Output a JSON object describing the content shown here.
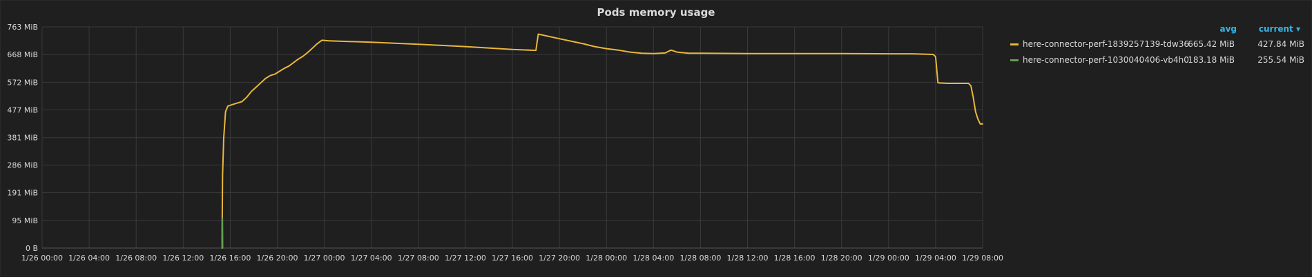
{
  "panel": {
    "title": "Pods memory usage"
  },
  "legend": {
    "avg_header": "avg",
    "current_header": "current ▾",
    "items": [
      {
        "name": "here-connector-perf-1839257139-tdw36",
        "avg": "665.42 MiB",
        "current": "427.84 MiB",
        "color": "#eab839"
      },
      {
        "name": "here-connector-perf-1030040406-vb4h0",
        "avg": "183.18 MiB",
        "current": "255.54 MiB",
        "color": "#629e51"
      }
    ]
  },
  "chart_data": {
    "type": "line",
    "title": "Pods memory usage",
    "xlabel": "",
    "ylabel": "",
    "grid": true,
    "legend_position": "right",
    "y_unit": "MiB",
    "ylim": [
      0,
      763
    ],
    "y_ticks": [
      "763 MiB",
      "668 MiB",
      "572 MiB",
      "477 MiB",
      "381 MiB",
      "286 MiB",
      "191 MiB",
      "95 MiB",
      "0 B"
    ],
    "y_tick_values": [
      763,
      668,
      572,
      477,
      381,
      286,
      191,
      95,
      0
    ],
    "x_hours_range": [
      0,
      80
    ],
    "x_ticks": [
      "1/26 00:00",
      "1/26 04:00",
      "1/26 08:00",
      "1/26 12:00",
      "1/26 16:00",
      "1/26 20:00",
      "1/27 00:00",
      "1/27 04:00",
      "1/27 08:00",
      "1/27 12:00",
      "1/27 16:00",
      "1/27 20:00",
      "1/28 00:00",
      "1/28 04:00",
      "1/28 08:00",
      "1/28 12:00",
      "1/28 16:00",
      "1/28 20:00",
      "1/29 00:00",
      "1/29 04:00",
      "1/29 08:00"
    ],
    "series": [
      {
        "name": "here-connector-perf-1839257139-tdw36",
        "color": "#eab839",
        "points": [
          [
            15.3,
            0
          ],
          [
            15.35,
            250
          ],
          [
            15.45,
            380
          ],
          [
            15.6,
            470
          ],
          [
            15.8,
            490
          ],
          [
            16.2,
            495
          ],
          [
            16.6,
            500
          ],
          [
            17.0,
            505
          ],
          [
            17.4,
            520
          ],
          [
            17.8,
            540
          ],
          [
            18.2,
            555
          ],
          [
            18.6,
            570
          ],
          [
            19.0,
            585
          ],
          [
            19.4,
            595
          ],
          [
            19.8,
            600
          ],
          [
            20.2,
            610
          ],
          [
            20.6,
            620
          ],
          [
            21.0,
            628
          ],
          [
            21.4,
            640
          ],
          [
            21.8,
            652
          ],
          [
            22.2,
            662
          ],
          [
            22.6,
            675
          ],
          [
            23.0,
            690
          ],
          [
            23.4,
            705
          ],
          [
            23.8,
            717
          ],
          [
            24.4,
            715
          ],
          [
            28.0,
            710
          ],
          [
            32.0,
            703
          ],
          [
            36.0,
            695
          ],
          [
            40.0,
            685
          ],
          [
            42.0,
            682
          ],
          [
            42.2,
            738
          ],
          [
            44.0,
            722
          ],
          [
            46.0,
            705
          ],
          [
            47.0,
            695
          ],
          [
            48.0,
            688
          ],
          [
            49.0,
            683
          ],
          [
            50.0,
            676
          ],
          [
            51.0,
            672
          ],
          [
            52.0,
            671
          ],
          [
            53.0,
            673
          ],
          [
            53.5,
            683
          ],
          [
            54.0,
            676
          ],
          [
            55.0,
            672
          ],
          [
            56.0,
            672
          ],
          [
            60.0,
            671
          ],
          [
            64.0,
            671
          ],
          [
            68.0,
            671
          ],
          [
            72.0,
            670
          ],
          [
            74.0,
            670
          ],
          [
            75.8,
            668
          ],
          [
            76.0,
            660
          ],
          [
            76.2,
            570
          ],
          [
            77.0,
            568
          ],
          [
            78.0,
            568
          ],
          [
            78.8,
            568
          ],
          [
            79.0,
            560
          ],
          [
            79.2,
            520
          ],
          [
            79.4,
            470
          ],
          [
            79.6,
            445
          ],
          [
            79.8,
            428
          ],
          [
            80.0,
            428
          ]
        ]
      },
      {
        "name": "here-connector-perf-1030040406-vb4h0",
        "color": "#629e51",
        "points": [
          [
            15.3,
            0
          ],
          [
            15.32,
            100
          ],
          [
            15.34,
            100
          ],
          [
            15.36,
            0
          ]
        ]
      }
    ]
  }
}
